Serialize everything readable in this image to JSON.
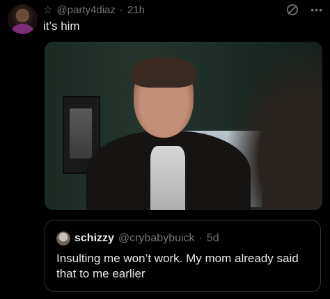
{
  "tweet": {
    "handle": "@party4diaz",
    "separator": "·",
    "time": "21h",
    "text": "it’s him"
  },
  "icons": {
    "star": "star-icon",
    "grok": "grok-icon",
    "more": "more-icon"
  },
  "quote": {
    "name": "schizzy",
    "handle": "@crybabybuick",
    "separator": "·",
    "time": "5d",
    "text": "Insulting me won’t work. My mom already said that to me earlier"
  },
  "colors": {
    "background": "#000000",
    "text": "#e7e9ea",
    "muted": "#71767b",
    "border": "#2f3336"
  }
}
